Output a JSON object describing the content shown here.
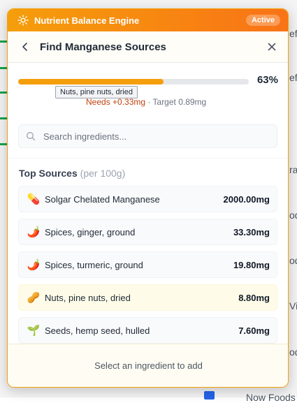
{
  "background": {
    "fragments": [
      "ef",
      "ef",
      "ra",
      "od",
      "od",
      "Vi",
      "od",
      "Now Foods"
    ]
  },
  "banner": {
    "title": "Nutrient Balance Engine",
    "badge": "Active",
    "icon": "sun-icon"
  },
  "header": {
    "title": "Find Manganese Sources",
    "back_icon": "chevron-left-icon",
    "close_icon": "close-icon"
  },
  "progress": {
    "percent_value": 63,
    "percent_label": "63%",
    "needs": "Needs +0.33mg",
    "separator": " · ",
    "target": "Target 0.89mg",
    "fill_color": "#f59e0b"
  },
  "tooltip": {
    "text": "Nuts, pine nuts, dried"
  },
  "search": {
    "placeholder": "Search ingredients...",
    "value": ""
  },
  "list": {
    "title": "Top Sources",
    "subtitle": "(per 100g)",
    "items": [
      {
        "emoji": "💊",
        "name": "Solgar Chelated Manganese",
        "value": "2000.00mg"
      },
      {
        "emoji": "🌶️",
        "name": "Spices, ginger, ground",
        "value": "33.30mg"
      },
      {
        "emoji": "🌶️",
        "name": "Spices, turmeric, ground",
        "value": "19.80mg"
      },
      {
        "emoji": "🥜",
        "name": "Nuts, pine nuts, dried",
        "value": "8.80mg"
      },
      {
        "emoji": "🌱",
        "name": "Seeds, hemp seed, hulled",
        "value": "7.60mg"
      }
    ]
  },
  "footer": {
    "text": "Select an ingredient to add"
  },
  "colors": {
    "accent": "#f59e0b",
    "accent_dark": "#f97316",
    "needs": "#c2410c"
  }
}
